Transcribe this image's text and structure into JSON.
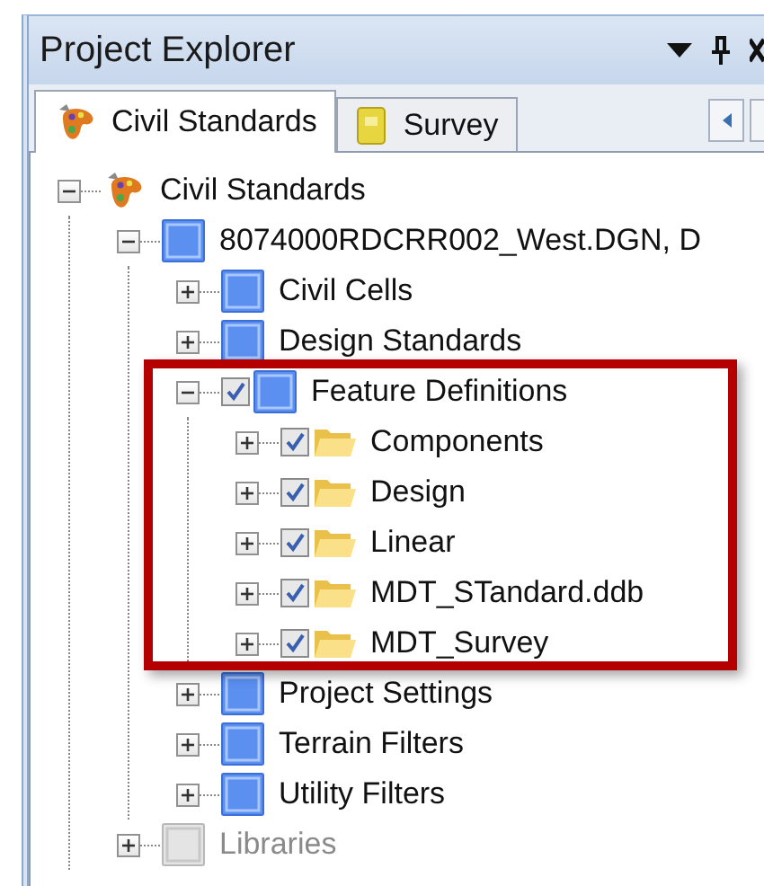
{
  "window": {
    "title": "Project Explorer"
  },
  "tabs": [
    {
      "label": "Civil Standards",
      "kind": "standards",
      "selected": true
    },
    {
      "label": "Survey",
      "kind": "book",
      "selected": false
    }
  ],
  "tree": [
    {
      "label": "Civil Standards",
      "kind": "standards",
      "expanded": true,
      "children": [
        {
          "label": "8074000RDCRR002_West.DGN, D",
          "kind": "dgn",
          "expanded": true,
          "children": [
            {
              "label": "Civil Cells",
              "kind": "dgn",
              "expanded": false
            },
            {
              "label": "Design Standards",
              "kind": "dgn",
              "expanded": false
            },
            {
              "label": "Feature Definitions",
              "kind": "dgn",
              "expanded": true,
              "checked": true,
              "children": [
                {
                  "label": "Components",
                  "kind": "folder",
                  "expanded": false,
                  "checked": true
                },
                {
                  "label": "Design",
                  "kind": "folder",
                  "expanded": false,
                  "checked": true
                },
                {
                  "label": "Linear",
                  "kind": "folder",
                  "expanded": false,
                  "checked": true
                },
                {
                  "label": "MDT_STandard.ddb",
                  "kind": "folder",
                  "expanded": false,
                  "checked": true
                },
                {
                  "label": "MDT_Survey",
                  "kind": "folder",
                  "expanded": false,
                  "checked": true
                }
              ]
            },
            {
              "label": "Project Settings",
              "kind": "dgn",
              "expanded": false
            },
            {
              "label": "Terrain Filters",
              "kind": "dgn",
              "expanded": false
            },
            {
              "label": "Utility Filters",
              "kind": "dgn",
              "expanded": false
            }
          ]
        },
        {
          "label": "Libraries",
          "kind": "dgn",
          "expanded": false,
          "disabled": true
        }
      ]
    }
  ]
}
